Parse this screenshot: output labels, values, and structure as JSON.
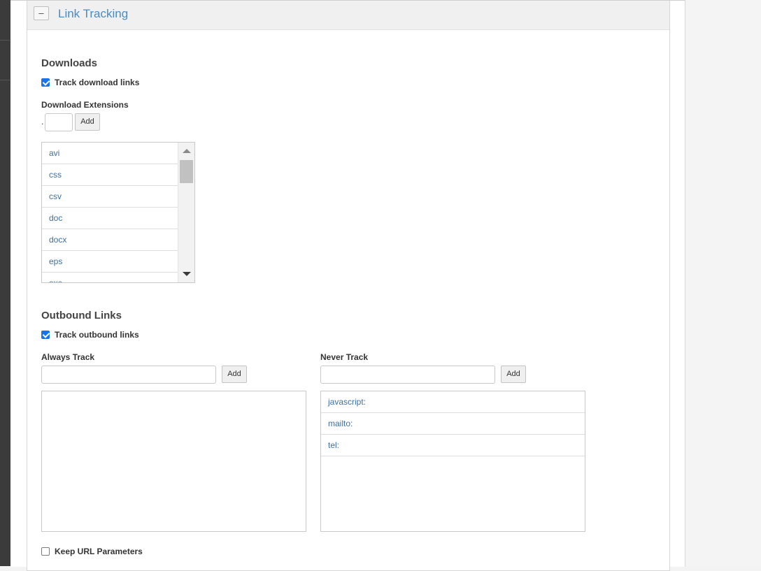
{
  "panel": {
    "collapse_label": "–",
    "title": "Link Tracking"
  },
  "downloads": {
    "section_title": "Downloads",
    "track_label": "Track download links",
    "track_checked": true,
    "extensions_label": "Download Extensions",
    "dot_prefix": ".",
    "input_value": "",
    "add_label": "Add",
    "extensions": [
      "avi",
      "css",
      "csv",
      "doc",
      "docx",
      "eps",
      "exe"
    ]
  },
  "outbound": {
    "section_title": "Outbound Links",
    "track_label": "Track outbound links",
    "track_checked": true,
    "always": {
      "label": "Always Track",
      "input_value": "",
      "add_label": "Add",
      "items": []
    },
    "never": {
      "label": "Never Track",
      "input_value": "",
      "add_label": "Add",
      "items": [
        "javascript:",
        "mailto:",
        "tel:"
      ]
    }
  },
  "keep_params": {
    "label": "Keep URL Parameters",
    "checked": false
  }
}
